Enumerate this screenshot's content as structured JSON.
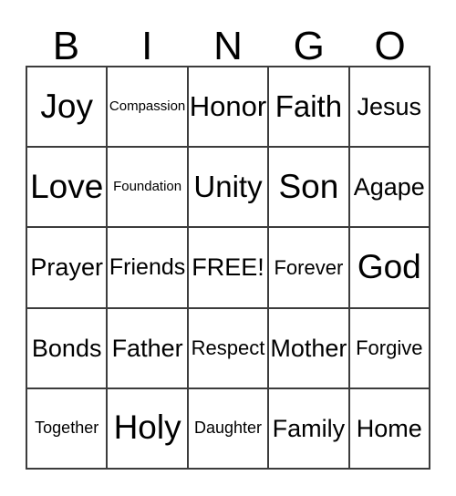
{
  "card": {
    "header_letters": [
      "B",
      "I",
      "N",
      "G",
      "O"
    ],
    "columns": [
      "B",
      "I",
      "N",
      "G",
      "O"
    ],
    "free_space_label": "FREE!",
    "colors": {
      "background": "#ffffff",
      "text": "#000000",
      "grid_line": "#3c3c3c"
    },
    "rows": [
      {
        "cells": [
          {
            "text": "Joy",
            "size": "fs-xl"
          },
          {
            "text": "Compassion",
            "size": "fs-xxs"
          },
          {
            "text": "Honor",
            "size": "fs-lg"
          },
          {
            "text": "Faith",
            "size": "fs-lg"
          },
          {
            "text": "Jesus",
            "size": "fs-md"
          }
        ]
      },
      {
        "cells": [
          {
            "text": "Love",
            "size": "fs-xl"
          },
          {
            "text": "Foundation",
            "size": "fs-xxs"
          },
          {
            "text": "Unity",
            "size": "fs-lg"
          },
          {
            "text": "Son",
            "size": "fs-xl"
          },
          {
            "text": "Agape",
            "size": "fs-md"
          }
        ]
      },
      {
        "cells": [
          {
            "text": "Prayer",
            "size": "fs-md"
          },
          {
            "text": "Friends",
            "size": "fs-md"
          },
          {
            "text": "FREE!",
            "size": "fs-md"
          },
          {
            "text": "Forever",
            "size": "fs-sm"
          },
          {
            "text": "God",
            "size": "fs-xl"
          }
        ]
      },
      {
        "cells": [
          {
            "text": "Bonds",
            "size": "fs-md"
          },
          {
            "text": "Father",
            "size": "fs-md"
          },
          {
            "text": "Respect",
            "size": "fs-sm"
          },
          {
            "text": "Mother",
            "size": "fs-md"
          },
          {
            "text": "Forgive",
            "size": "fs-sm"
          }
        ]
      },
      {
        "cells": [
          {
            "text": "Together",
            "size": "fs-xs"
          },
          {
            "text": "Holy",
            "size": "fs-xl"
          },
          {
            "text": "Daughter",
            "size": "fs-xs"
          },
          {
            "text": "Family",
            "size": "fs-md"
          },
          {
            "text": "Home",
            "size": "fs-md"
          }
        ]
      }
    ]
  }
}
